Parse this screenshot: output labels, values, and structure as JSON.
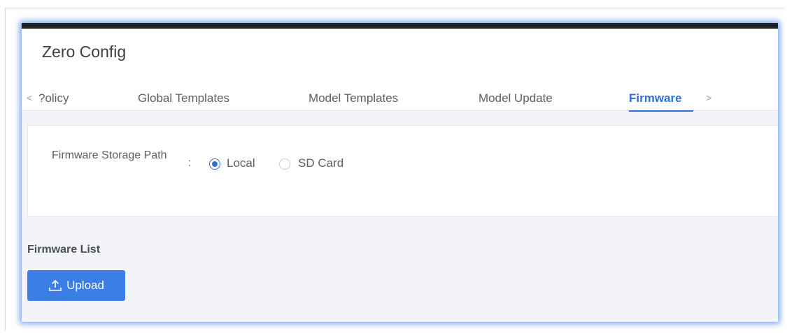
{
  "page": {
    "title": "Zero Config"
  },
  "tabs": {
    "prev_icon": "chevron-left-icon",
    "next_icon": "chevron-right-icon",
    "items": [
      {
        "label": "Policy",
        "shown": "?olicy"
      },
      {
        "label": "Global Templates"
      },
      {
        "label": "Model Templates"
      },
      {
        "label": "Model Update"
      },
      {
        "label": "Firmware",
        "active": true
      }
    ]
  },
  "settings": {
    "storage_path_label": "Firmware Storage Path",
    "colon": ":",
    "options": [
      {
        "label": "Local",
        "selected": true
      },
      {
        "label": "SD Card",
        "selected": false
      }
    ]
  },
  "firmware_list": {
    "title": "Firmware List",
    "upload_label": "Upload",
    "upload_icon": "upload-icon"
  },
  "colors": {
    "accent": "#2e6fd8",
    "button": "#3a7ee6",
    "frame_glow": "#508ce6",
    "top_bar": "#1f2126"
  }
}
